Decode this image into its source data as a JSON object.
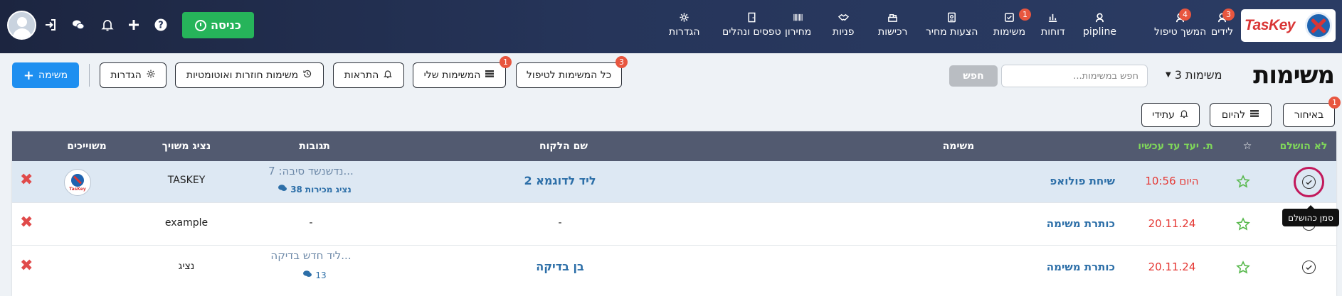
{
  "app": {
    "logo_text": "TasKey"
  },
  "nav": {
    "items": [
      {
        "id": "leads",
        "label": "לידים",
        "icon": "person-icon",
        "badge": "3"
      },
      {
        "id": "followups",
        "label": "המשך טיפול",
        "icon": "person-icon",
        "badge": "4"
      },
      {
        "id": "pipline",
        "label": "pipline",
        "icon": "person-icon",
        "badge": ""
      },
      {
        "id": "reports",
        "label": "דוחות",
        "icon": "bar-chart-icon",
        "badge": ""
      },
      {
        "id": "tasks",
        "label": "משימות",
        "icon": "checkbox-icon",
        "badge": "1"
      },
      {
        "id": "quotes",
        "label": "הצעות מחיר",
        "icon": "document-icon",
        "badge": ""
      },
      {
        "id": "purchases",
        "label": "רכישות",
        "icon": "cash-register-icon",
        "badge": ""
      },
      {
        "id": "inquiries",
        "label": "פניות",
        "icon": "handshake-icon",
        "badge": ""
      },
      {
        "id": "pricelist",
        "label": "מחירון",
        "icon": "barcode-icon",
        "badge": ""
      },
      {
        "id": "forms",
        "label": "טפסים ונהלים",
        "icon": "door-icon",
        "badge": ""
      },
      {
        "id": "settings",
        "label": "הגדרות",
        "icon": "gear-icon",
        "badge": ""
      }
    ],
    "enter_label": "כניסה"
  },
  "header": {
    "title": "משימות",
    "count_label": "3 משימות",
    "search_placeholder": "חפש במשימות...",
    "search_button": "חפש",
    "filters": {
      "all_tasks": {
        "label": "כל המשימות לטיפול",
        "badge": "3"
      },
      "my_tasks": {
        "label": "המשימות שלי",
        "badge": "1"
      },
      "alerts": {
        "label": "התראות"
      },
      "recurring": {
        "label": "משימות חוזרות ואוטומטיות"
      },
      "settings": {
        "label": "הגדרות"
      }
    },
    "new_task_label": "משימה"
  },
  "time_filters": {
    "late": {
      "label": "באיחור",
      "badge": "1"
    },
    "today": {
      "label": "להיום"
    },
    "future": {
      "label": "עתידי"
    }
  },
  "table": {
    "headers": {
      "not_done": "לא הושלם",
      "star": "☆",
      "due": "ת. יעד עד עכשיו",
      "task": "משימה",
      "client": "שם הלקוח",
      "responses": "תגובות",
      "rep": "נציג משויך",
      "assignees": "משוייכים"
    },
    "rows": [
      {
        "due": "היום 10:56",
        "task": "שיחת פולואפ",
        "client": "ליד לדוגמא 2",
        "response_text": "נדשנשד סיבה: 7...",
        "response_count": "38",
        "response_author": "נציג מכירות",
        "rep": "TASKEY",
        "has_avatar": true
      },
      {
        "due": "20.11.24",
        "task": "כותרת משימה",
        "client": "-",
        "response_text": "-",
        "response_count": "",
        "response_author": "",
        "rep": "example",
        "has_avatar": false
      },
      {
        "due": "20.11.24",
        "task": "כותרת משימה",
        "client": "בן בדיקה",
        "response_text": "ליד חדש בדיקה...",
        "response_count": "13",
        "response_author": "",
        "rep": "נציג",
        "has_avatar": false
      }
    ]
  },
  "tooltip": {
    "text": "סמן כהושלם"
  },
  "mini_logo_text": "TasKey",
  "colors": {
    "navbar": "#26355a",
    "enter_button": "#26b45a",
    "primary": "#1e8ff0",
    "badge": "#e8563f",
    "due_red": "#e53935",
    "link_blue": "#2d6fa8",
    "green_header": "#7fd65a",
    "delete_red": "#e04a4a"
  }
}
